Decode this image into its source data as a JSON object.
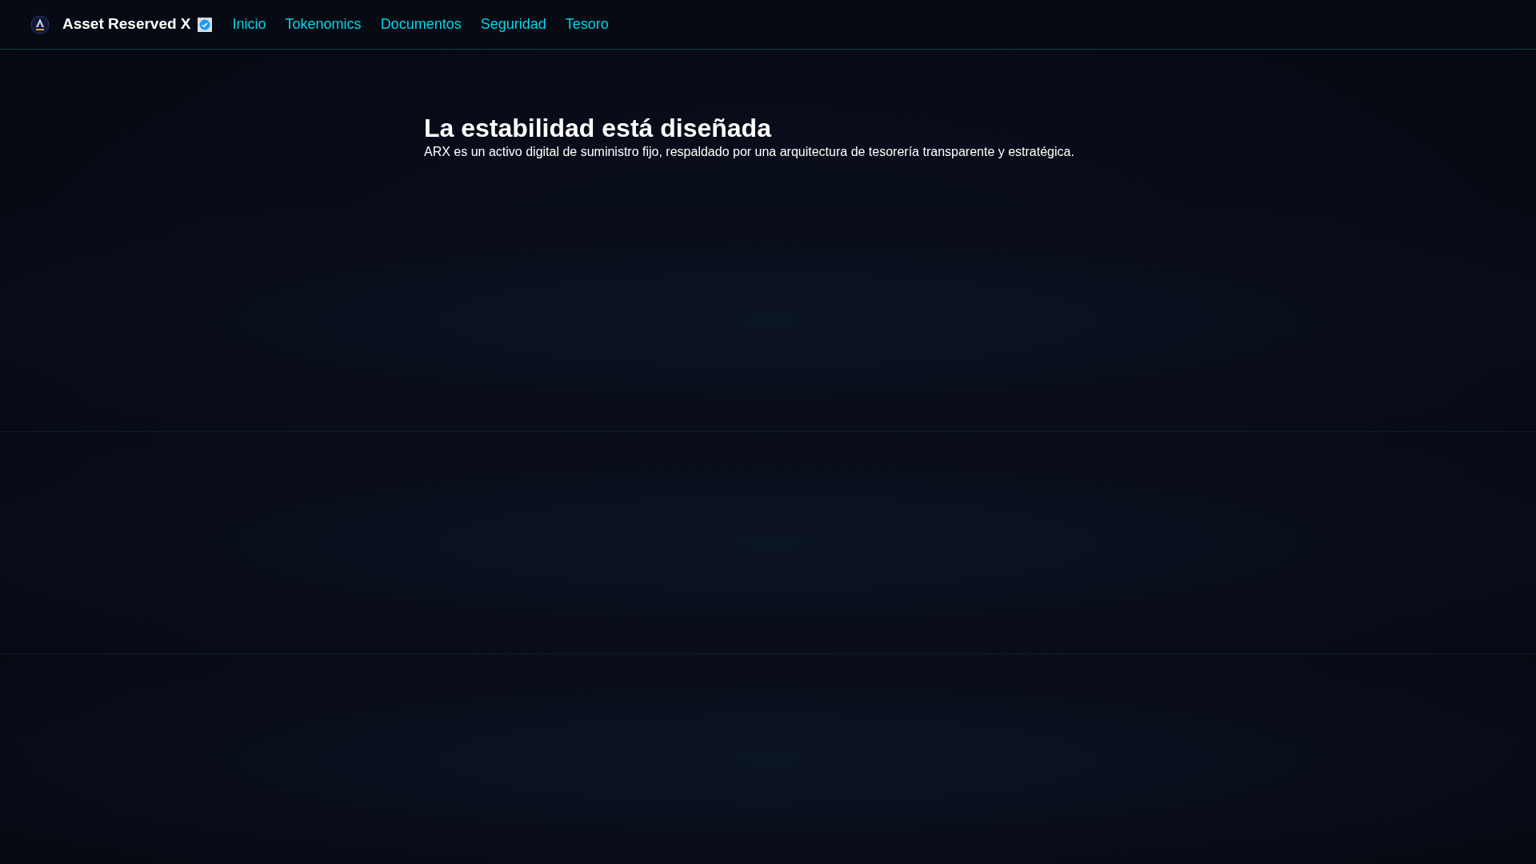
{
  "header": {
    "brand": "Asset Reserved X",
    "verified": true,
    "nav": [
      {
        "label": "Inicio"
      },
      {
        "label": "Tokenomics"
      },
      {
        "label": "Documentos"
      },
      {
        "label": "Seguridad"
      },
      {
        "label": "Tesoro"
      }
    ]
  },
  "hero": {
    "title": "La estabilidad está diseñada",
    "subtitle": "ARX es un activo digital de suministro fijo, respaldado por una arquitectura de tesorería transparente y estratégica."
  }
}
